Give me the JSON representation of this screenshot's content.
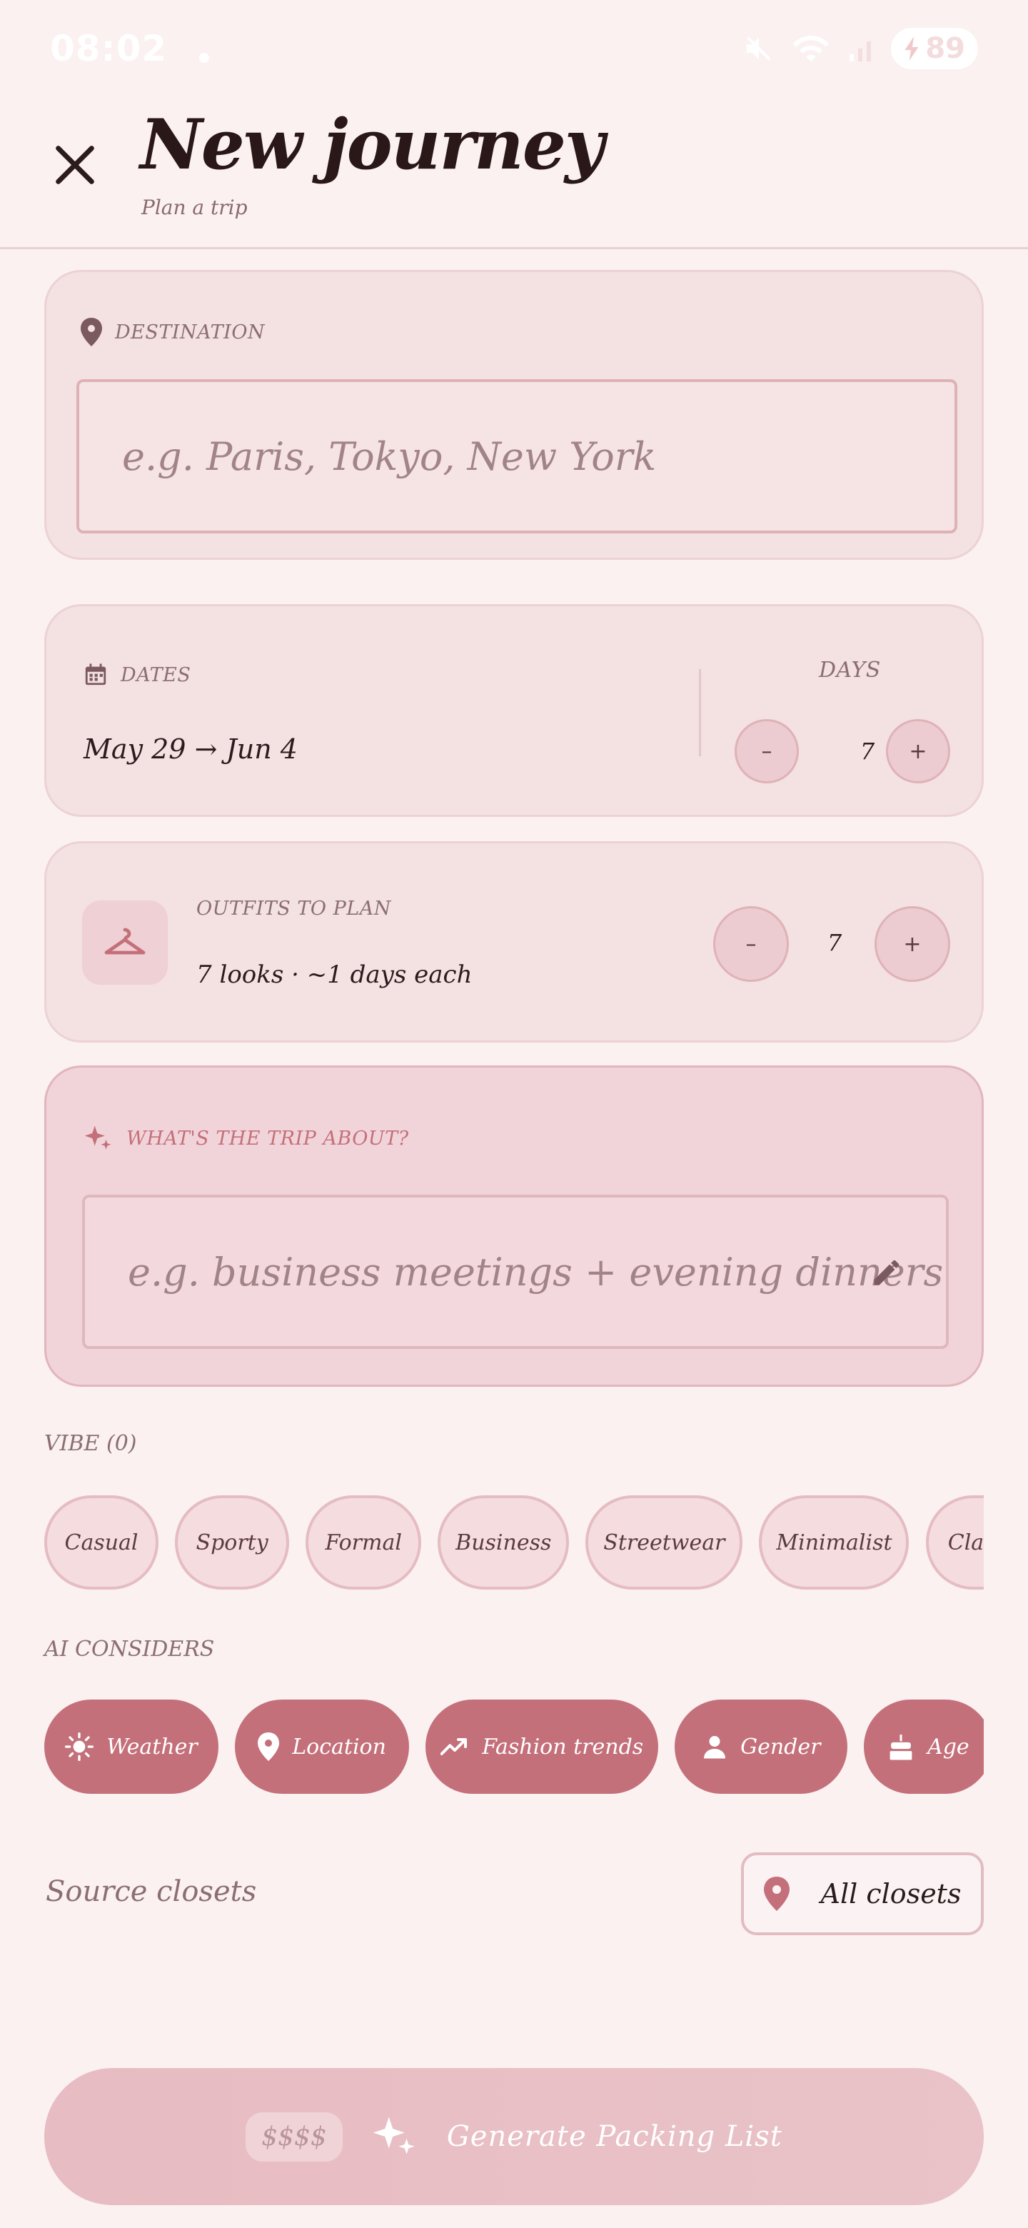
{
  "status_bar": {
    "time": "08:02",
    "battery": "89"
  },
  "header": {
    "title": "New journey",
    "subtitle": "Plan a trip"
  },
  "destination": {
    "label": "DESTINATION",
    "placeholder": "e.g. Paris, Tokyo, New York"
  },
  "dates": {
    "label": "DATES",
    "range_start": "May 29",
    "arrow": "→",
    "range_end": "Jun 4",
    "days_label": "DAYS",
    "days_value": "7",
    "minus": "–",
    "plus": "+"
  },
  "outfits": {
    "label": "OUTFITS TO PLAN",
    "summary": "7 looks · ~1 days each",
    "value": "7",
    "minus": "–",
    "plus": "+"
  },
  "trip_about": {
    "label": "WHAT'S THE TRIP ABOUT?",
    "placeholder": "e.g. business meetings + evening dinners"
  },
  "vibe": {
    "label": "VIBE (0)",
    "chips": [
      "Casual",
      "Sporty",
      "Formal",
      "Business",
      "Streetwear",
      "Minimalist",
      "Classic"
    ]
  },
  "ai_considers": {
    "label": "AI CONSIDERS",
    "chips": [
      {
        "label": "Weather",
        "icon": "sun-icon"
      },
      {
        "label": "Location",
        "icon": "pin-icon"
      },
      {
        "label": "Fashion trends",
        "icon": "trending-up-icon"
      },
      {
        "label": "Gender",
        "icon": "person-icon"
      },
      {
        "label": "Age",
        "icon": "cake-icon"
      }
    ]
  },
  "source_closets": {
    "label": "Source closets",
    "button": "All closets"
  },
  "generate": {
    "price": "$$$$",
    "label": "Generate Packing List"
  },
  "colors": {
    "accent": "#c4707a",
    "background": "#faf1f0",
    "card": "#f4e1e2"
  }
}
